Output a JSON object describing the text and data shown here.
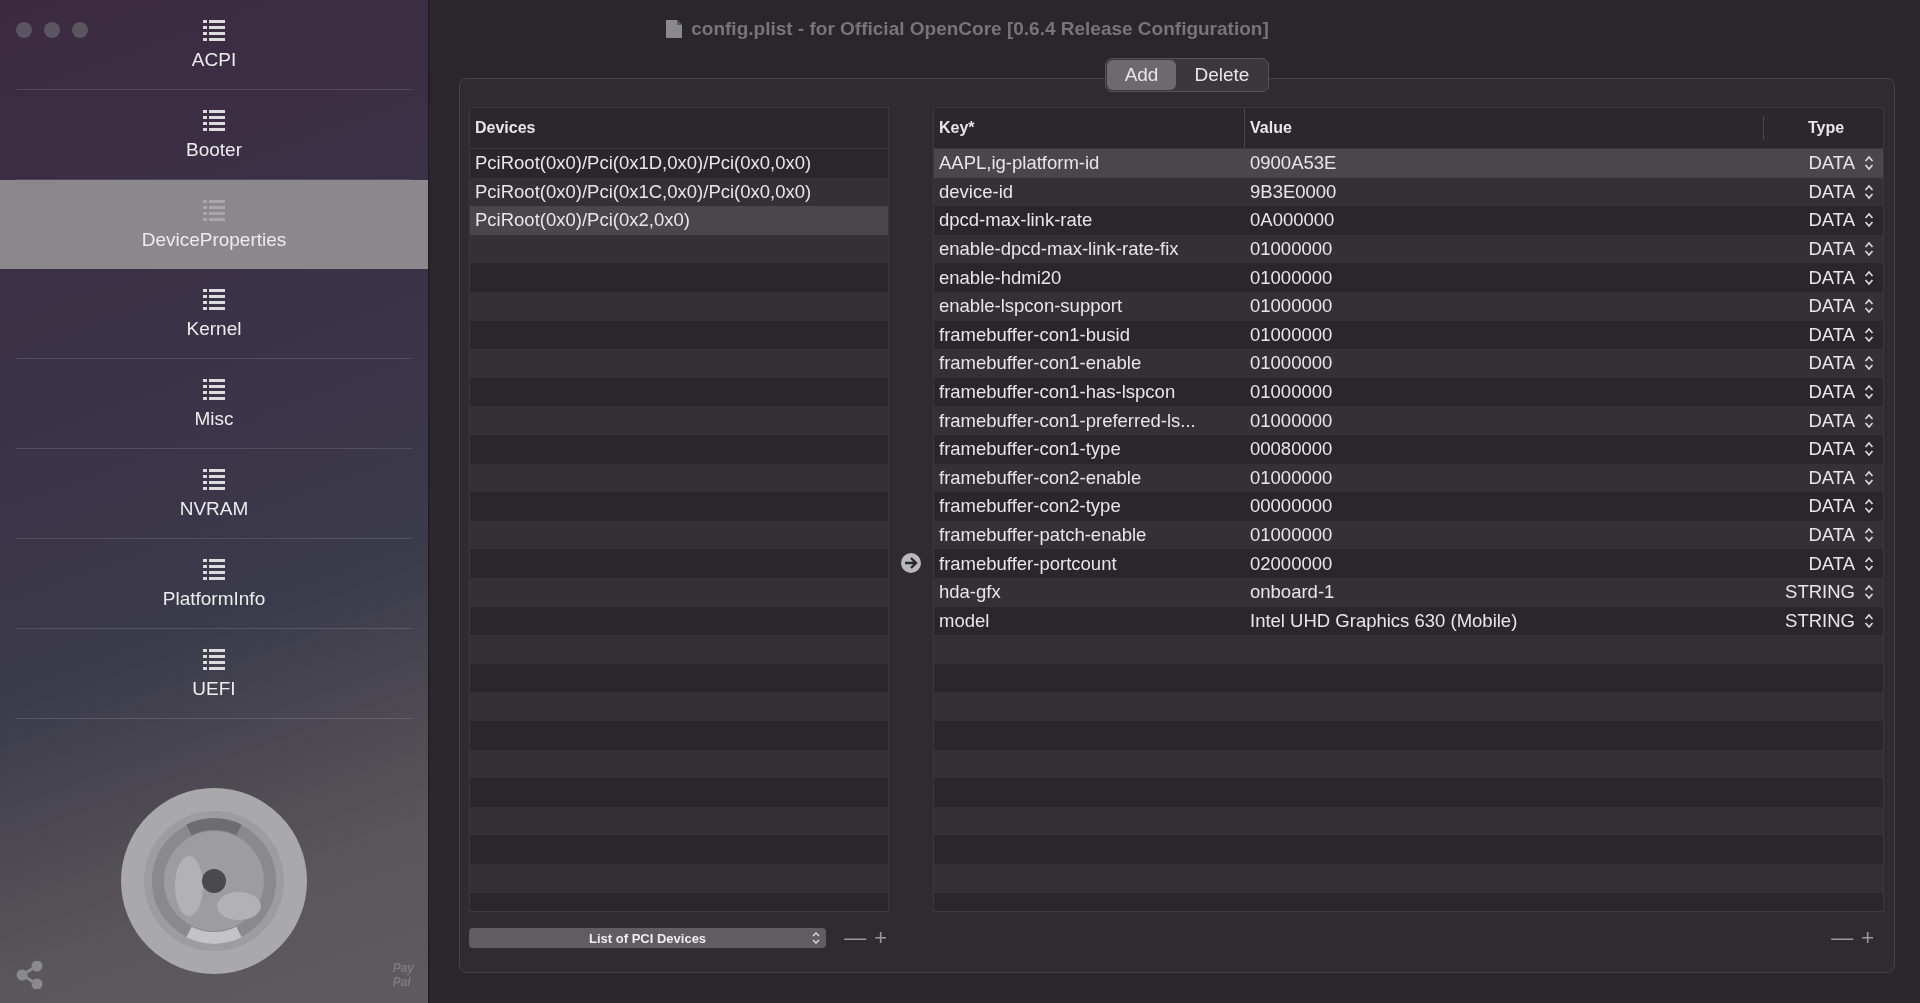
{
  "window": {
    "title": "config.plist - for Official OpenCore [0.6.4 Release Configuration]"
  },
  "sidebar": {
    "items": [
      {
        "label": "ACPI",
        "selected": false
      },
      {
        "label": "Booter",
        "selected": false
      },
      {
        "label": "DeviceProperties",
        "selected": true
      },
      {
        "label": "Kernel",
        "selected": false
      },
      {
        "label": "Misc",
        "selected": false
      },
      {
        "label": "NVRAM",
        "selected": false
      },
      {
        "label": "PlatformInfo",
        "selected": false
      },
      {
        "label": "UEFI",
        "selected": false
      }
    ],
    "donate": [
      "Pay",
      "Pal"
    ]
  },
  "segments": [
    {
      "label": "Add",
      "selected": true
    },
    {
      "label": "Delete",
      "selected": false
    }
  ],
  "devices": {
    "heading": "Devices",
    "items": [
      {
        "label": "PciRoot(0x0)/Pci(0x1D,0x0)/Pci(0x0,0x0)",
        "selected": false
      },
      {
        "label": "PciRoot(0x0)/Pci(0x1C,0x0)/Pci(0x0,0x0)",
        "selected": false
      },
      {
        "label": "PciRoot(0x0)/Pci(0x2,0x0)",
        "selected": true
      }
    ],
    "popup": "List of PCI Devices",
    "remove": "—",
    "add": "+"
  },
  "properties": {
    "columns": [
      "Key*",
      "Value",
      "Type"
    ],
    "rows": [
      {
        "key": "AAPL,ig-platform-id",
        "value": "0900A53E",
        "type": "DATA",
        "selected": true
      },
      {
        "key": "device-id",
        "value": "9B3E0000",
        "type": "DATA",
        "selected": false
      },
      {
        "key": "dpcd-max-link-rate",
        "value": "0A000000",
        "type": "DATA",
        "selected": false
      },
      {
        "key": "enable-dpcd-max-link-rate-fix",
        "value": "01000000",
        "type": "DATA",
        "selected": false
      },
      {
        "key": "enable-hdmi20",
        "value": "01000000",
        "type": "DATA",
        "selected": false
      },
      {
        "key": "enable-lspcon-support",
        "value": "01000000",
        "type": "DATA",
        "selected": false
      },
      {
        "key": "framebuffer-con1-busid",
        "value": "01000000",
        "type": "DATA",
        "selected": false
      },
      {
        "key": "framebuffer-con1-enable",
        "value": "01000000",
        "type": "DATA",
        "selected": false
      },
      {
        "key": "framebuffer-con1-has-lspcon",
        "value": "01000000",
        "type": "DATA",
        "selected": false
      },
      {
        "key": "framebuffer-con1-preferred-ls...",
        "value": "01000000",
        "type": "DATA",
        "selected": false
      },
      {
        "key": "framebuffer-con1-type",
        "value": "00080000",
        "type": "DATA",
        "selected": false
      },
      {
        "key": "framebuffer-con2-enable",
        "value": "01000000",
        "type": "DATA",
        "selected": false
      },
      {
        "key": "framebuffer-con2-type",
        "value": "00000000",
        "type": "DATA",
        "selected": false
      },
      {
        "key": "framebuffer-patch-enable",
        "value": "01000000",
        "type": "DATA",
        "selected": false
      },
      {
        "key": "framebuffer-portcount",
        "value": "02000000",
        "type": "DATA",
        "selected": false
      },
      {
        "key": "hda-gfx",
        "value": "onboard-1",
        "type": "STRING",
        "selected": false
      },
      {
        "key": "model",
        "value": "Intel UHD Graphics 630 (Mobile)",
        "type": "STRING",
        "selected": false
      }
    ],
    "remove": "—",
    "add": "+"
  }
}
